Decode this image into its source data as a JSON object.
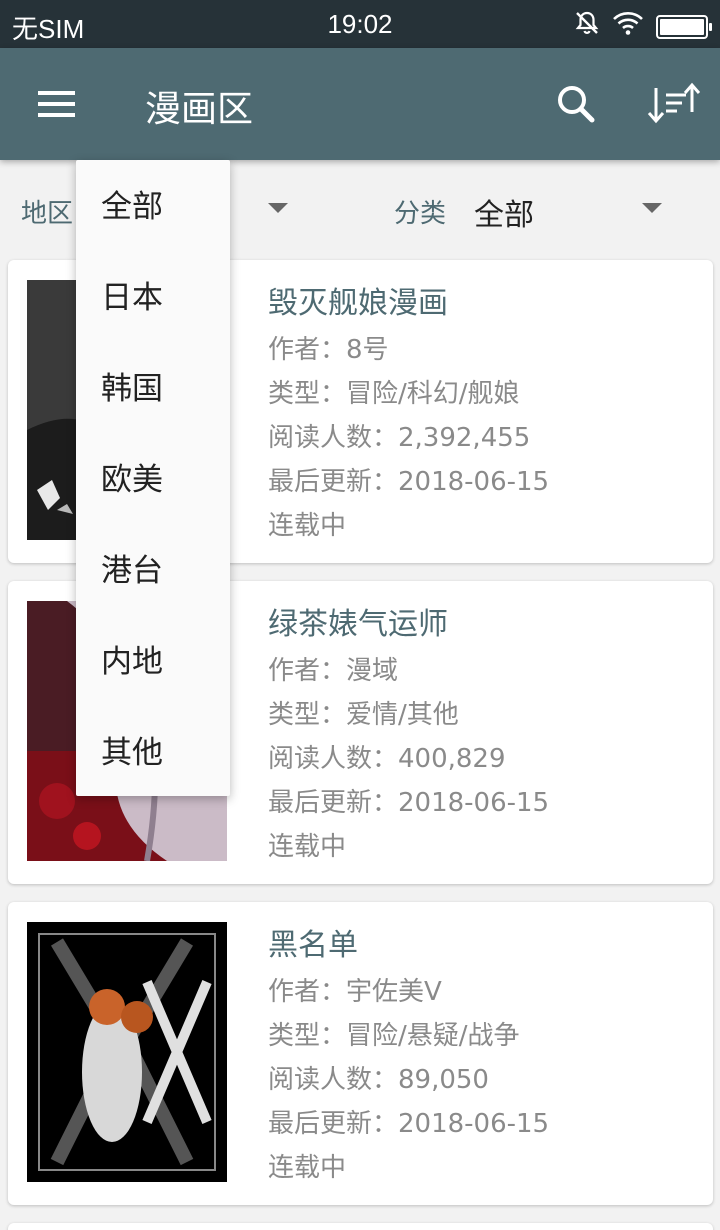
{
  "status_bar": {
    "carrier": "无SIM",
    "time": "19:02"
  },
  "toolbar": {
    "title": "漫画区",
    "menu_icon": "hamburger-menu-icon",
    "search_icon": "search-icon",
    "sort_icon": "sort-icon"
  },
  "filters": {
    "region": {
      "label": "地区",
      "value": "全部"
    },
    "category": {
      "label": "分类",
      "value": "全部"
    }
  },
  "region_dropdown": {
    "options": [
      "全部",
      "日本",
      "韩国",
      "欧美",
      "港台",
      "内地",
      "其他"
    ]
  },
  "comics": [
    {
      "title": "毁灭舰娘漫画",
      "author": "作者：8号",
      "genre": "类型：冒险/科幻/舰娘",
      "readers": "阅读人数：2,392,455",
      "updated": "最后更新：2018-06-15",
      "status": "连载中"
    },
    {
      "title": "绿茶婊气运师",
      "author": "作者：漫域",
      "genre": "类型：爱情/其他",
      "readers": "阅读人数：400,829",
      "updated": "最后更新：2018-06-15",
      "status": "连载中"
    },
    {
      "title": "黑名单",
      "author": "作者：宇佐美V",
      "genre": "类型：冒险/悬疑/战争",
      "readers": "阅读人数：89,050",
      "updated": "最后更新：2018-06-15",
      "status": "连载中"
    }
  ],
  "colors": {
    "toolbar": "#4e6a72",
    "status_bar": "#263238",
    "accent_text": "#4e6a72"
  }
}
